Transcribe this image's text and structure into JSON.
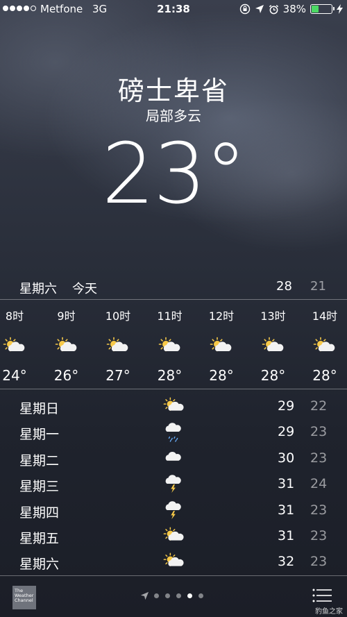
{
  "status_bar": {
    "carrier": "Metfone",
    "network": "3G",
    "time": "21:38",
    "battery_percent": "38%",
    "battery_level": 0.38,
    "battery_color": "#4cd964"
  },
  "header": {
    "city": "磅士卑省",
    "condition": "局部多云",
    "temperature": "23°"
  },
  "today": {
    "day": "星期六",
    "label": "今天",
    "high": "28",
    "low": "21"
  },
  "hourly": [
    {
      "time": "8时",
      "icon": "partly-sunny-icon",
      "temp": "24°"
    },
    {
      "time": "9时",
      "icon": "partly-sunny-icon",
      "temp": "26°"
    },
    {
      "time": "10时",
      "icon": "partly-sunny-icon",
      "temp": "27°"
    },
    {
      "time": "11时",
      "icon": "partly-sunny-icon",
      "temp": "28°"
    },
    {
      "time": "12时",
      "icon": "partly-sunny-icon",
      "temp": "28°"
    },
    {
      "time": "13时",
      "icon": "partly-sunny-icon",
      "temp": "28°"
    },
    {
      "time": "14时",
      "icon": "partly-sunny-icon",
      "temp": "28°"
    }
  ],
  "daily": [
    {
      "day": "星期日",
      "icon": "partly-sunny-icon",
      "high": "29",
      "low": "22"
    },
    {
      "day": "星期一",
      "icon": "rain-cloud-icon",
      "high": "29",
      "low": "23"
    },
    {
      "day": "星期二",
      "icon": "cloud-icon",
      "high": "30",
      "low": "23"
    },
    {
      "day": "星期三",
      "icon": "thunderstorm-icon",
      "high": "31",
      "low": "24"
    },
    {
      "day": "星期四",
      "icon": "thunderstorm-icon",
      "high": "31",
      "low": "23"
    },
    {
      "day": "星期五",
      "icon": "partly-sunny-icon",
      "high": "31",
      "low": "23"
    },
    {
      "day": "星期六",
      "icon": "partly-sunny-icon",
      "high": "32",
      "low": "23"
    }
  ],
  "bottom_bar": {
    "logo_text": [
      "The",
      "Weather",
      "Channel"
    ],
    "pages_total": 5,
    "pages_current": 4,
    "watermark": "豹鱼之家"
  }
}
